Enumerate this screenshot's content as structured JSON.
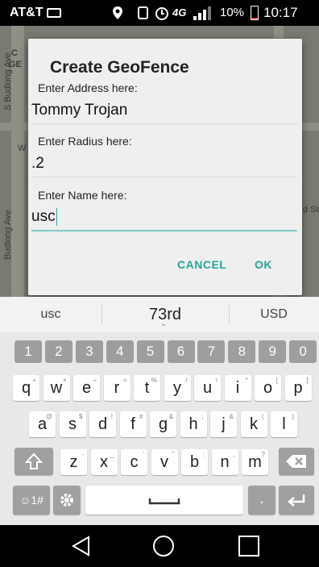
{
  "status_bar": {
    "carrier": "AT&T",
    "battery_percent": "10%",
    "battery_level": 0.1,
    "time": "10:17 PM",
    "network": "4G",
    "icons": [
      "rec-icon",
      "location-pin-icon",
      "phone-icon",
      "alarm-icon",
      "signal-icon",
      "battery-icon"
    ]
  },
  "map": {
    "labels": [
      "S Budlong Ave",
      "Budlong Ave",
      "W",
      "W",
      "C",
      "GE",
      "d St"
    ]
  },
  "dialog": {
    "title": "Create GeoFence",
    "fields": [
      {
        "label": "Enter Address here:",
        "value": "Tommy Trojan"
      },
      {
        "label": "Enter Radius here:",
        "value": ".2"
      },
      {
        "label": "Enter Name here:",
        "value": "usc"
      }
    ],
    "cancel_label": "CANCEL",
    "ok_label": "OK",
    "accent": "#26a69a"
  },
  "suggestions": [
    "usc",
    "73rd",
    "USD"
  ],
  "keyboard": {
    "number_row": [
      "1",
      "2",
      "3",
      "4",
      "5",
      "6",
      "7",
      "8",
      "9",
      "0"
    ],
    "row1": [
      {
        "key": "q",
        "sec": "+"
      },
      {
        "key": "w",
        "sec": "×"
      },
      {
        "key": "e",
        "sec": "÷"
      },
      {
        "key": "r",
        "sec": "="
      },
      {
        "key": "t",
        "sec": "%"
      },
      {
        "key": "y",
        "sec": "/"
      },
      {
        "key": "u",
        "sec": "\\"
      },
      {
        "key": "i",
        "sec": "*"
      },
      {
        "key": "o",
        "sec": "["
      },
      {
        "key": "p",
        "sec": "]"
      }
    ],
    "row2": [
      {
        "key": "a",
        "sec": "@"
      },
      {
        "key": "s",
        "sec": "$"
      },
      {
        "key": "d",
        "sec": "!"
      },
      {
        "key": "f",
        "sec": "#"
      },
      {
        "key": "g",
        "sec": "&"
      },
      {
        "key": "h",
        "sec": ";"
      },
      {
        "key": "j",
        "sec": "&"
      },
      {
        "key": "k",
        "sec": "("
      },
      {
        "key": "l",
        "sec": ")"
      }
    ],
    "row3": [
      {
        "key": "z",
        "sec": "-"
      },
      {
        "key": "x",
        "sec": "_"
      },
      {
        "key": "c",
        "sec": "'"
      },
      {
        "key": "v",
        "sec": "\""
      },
      {
        "key": "b",
        "sec": ":"
      },
      {
        "key": "n",
        "sec": ","
      },
      {
        "key": "m",
        "sec": "?"
      }
    ],
    "symbols_label": "☺1#",
    "shift_icon": "shift-icon",
    "backspace_icon": "backspace-icon",
    "settings_icon": "gear-icon",
    "space_icon": "spacebar-icon",
    "period_label": ".",
    "enter_icon": "enter-icon"
  },
  "nav_bar": {
    "icons": [
      "back-icon",
      "home-icon",
      "recent-apps-icon"
    ]
  }
}
